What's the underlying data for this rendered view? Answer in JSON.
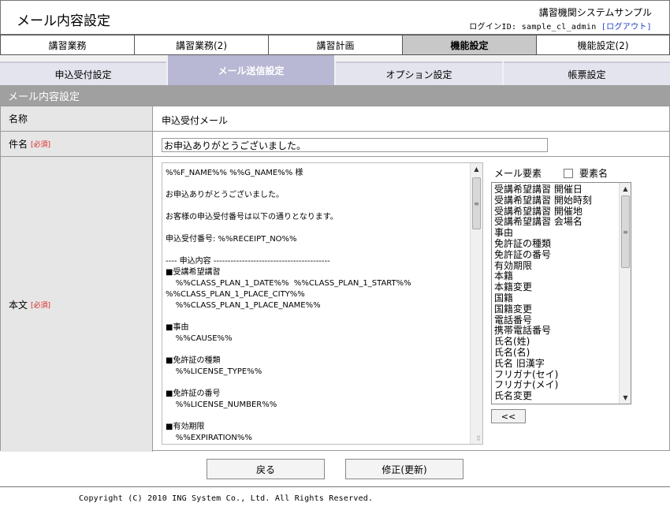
{
  "header": {
    "title": "メール内容設定",
    "system_name": "講習機関システムサンプル",
    "login_label": "ログインID: sample_cl_admin",
    "logout_link": "[ログアウト]"
  },
  "main_tabs": [
    {
      "label": "講習業務",
      "active": false
    },
    {
      "label": "講習業務(2)",
      "active": false
    },
    {
      "label": "講習計画",
      "active": false
    },
    {
      "label": "機能設定",
      "active": true
    },
    {
      "label": "機能設定(2)",
      "active": false
    }
  ],
  "sub_tabs": [
    {
      "label": "申込受付設定",
      "active": false
    },
    {
      "label": "メール送信設定",
      "active": true
    },
    {
      "label": "オプション設定",
      "active": false
    },
    {
      "label": "帳票設定",
      "active": false
    }
  ],
  "section_title": "メール内容設定",
  "form": {
    "name_label": "名称",
    "name_value": "申込受付メール",
    "subject_label": "件名",
    "subject_required": "[必須]",
    "subject_value": "お申込ありがとうございました。",
    "body_label": "本文",
    "body_required": "[必須]",
    "body_lines": [
      "%%F_NAME%% %%G_NAME%% 様",
      "",
      "お申込ありがとうございました。",
      "",
      "お客様の申込受付番号は以下の通りとなります。",
      "",
      "申込受付番号: %%RECEIPT_NO%%",
      "",
      "---- 申込内容 -----------------------------------------",
      "■受講希望講習",
      "    %%CLASS_PLAN_1_DATE%%  %%CLASS_PLAN_1_START%%",
      "%%CLASS_PLAN_1_PLACE_CITY%%",
      "    %%CLASS_PLAN_1_PLACE_NAME%%",
      "",
      "■事由",
      "    %%CAUSE%%",
      "",
      "■免許証の種類",
      "    %%LICENSE_TYPE%%",
      "",
      "■免許証の番号",
      "    %%LICENSE_NUMBER%%",
      "",
      "■有効期限",
      "    %%EXPIRATION%%"
    ]
  },
  "elements": {
    "header_label": "メール要素",
    "checkbox_label": "要素名",
    "checkbox_checked": false,
    "items": [
      "受講希望講習 開催日",
      "受講希望講習 開始時刻",
      "受講希望講習 開催地",
      "受講希望講習 会場名",
      "事由",
      "免許証の種類",
      "免許証の番号",
      "有効期限",
      "本籍",
      "本籍変更",
      "国籍",
      "国籍変更",
      "電話番号",
      "携帯電話番号",
      "氏名(姓)",
      "氏名(名)",
      "氏名 旧漢字",
      "フリガナ(セイ)",
      "フリガナ(メイ)",
      "氏名変更"
    ],
    "insert_button": "<<"
  },
  "buttons": {
    "back": "戻る",
    "update": "修正(更新)"
  },
  "footer": {
    "copyright": "Copyright (C) 2010 ING System Co., Ltd. All Rights Reserved."
  },
  "colors": {
    "active_subtab": "#b8b8d4",
    "section_bar": "#a0a0a0",
    "label_bg": "#e6e6e6",
    "required": "#dd2222",
    "link": "#1a3cc8"
  },
  "icons": {
    "scroll_up": "triangle-up-icon",
    "scroll_down": "triangle-down-icon",
    "resize": "resize-grip-icon"
  }
}
